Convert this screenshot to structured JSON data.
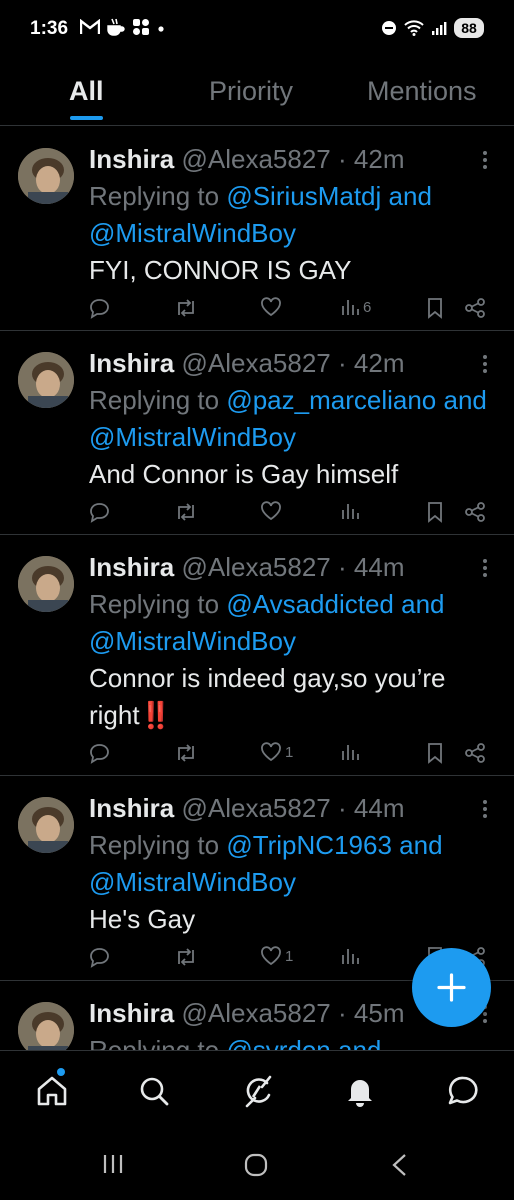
{
  "status_bar": {
    "time": "1:36",
    "battery": "88",
    "left_icons": [
      "gmail-icon",
      "coffee-icon",
      "app-grid-icon",
      "dot-icon"
    ],
    "right_icons": [
      "do-not-disturb-icon",
      "wifi-icon",
      "signal-icon",
      "battery-icon"
    ]
  },
  "tabs": [
    {
      "label": "All",
      "active": true
    },
    {
      "label": "Priority",
      "active": false
    },
    {
      "label": "Mentions",
      "active": false
    }
  ],
  "tweets": [
    {
      "name": "Inshira",
      "handle": "@Alexa5827",
      "separator": "·",
      "time": "42m",
      "replying_prefix": "Replying to",
      "mention_1": "@SiriusMatdj",
      "conjunction": "and",
      "mention_2": "@MistralWindBoy",
      "text": "FYI, CONNOR IS GAY",
      "likes": "",
      "views": "6"
    },
    {
      "name": "Inshira",
      "handle": "@Alexa5827",
      "separator": "·",
      "time": "42m",
      "replying_prefix": "Replying to",
      "mention_1": "@paz_marceliano",
      "conjunction": "and",
      "mention_2": "@MistralWindBoy",
      "text": "And Connor is Gay himself",
      "likes": "",
      "views": ""
    },
    {
      "name": "Inshira",
      "handle": "@Alexa5827",
      "separator": "·",
      "time": "44m",
      "replying_prefix": "Replying to",
      "mention_1": "@Avsaddicted",
      "conjunction": "and",
      "mention_2": "@MistralWindBoy",
      "text": "Connor is indeed gay,so you’re right",
      "emoji": "‼️",
      "likes": "1",
      "views": ""
    },
    {
      "name": "Inshira",
      "handle": "@Alexa5827",
      "separator": "·",
      "time": "44m",
      "replying_prefix": "Replying to",
      "mention_1": "@TripNC1963",
      "conjunction": "and",
      "mention_2": "@MistralWindBoy",
      "text": "He's Gay",
      "likes": "1",
      "views": ""
    },
    {
      "name": "Inshira",
      "handle": "@Alexa5827",
      "separator": "·",
      "time": "45m",
      "replying_prefix": "Replying to",
      "mention_1": "@syrdon",
      "conjunction": "and",
      "mention_2": "",
      "text": "",
      "likes": "",
      "views": ""
    }
  ],
  "fab": {
    "icon": "plus-icon"
  },
  "bottom_nav": [
    "home-icon",
    "search-icon",
    "grok-icon",
    "notifications-icon",
    "messages-icon"
  ],
  "system_nav": [
    "recents-icon",
    "home-circle-icon",
    "back-icon"
  ],
  "colors": {
    "accent": "#1d9bf0",
    "background": "#000000",
    "muted": "#71767b",
    "text": "#e7e9ea",
    "divider": "#2f3336"
  }
}
